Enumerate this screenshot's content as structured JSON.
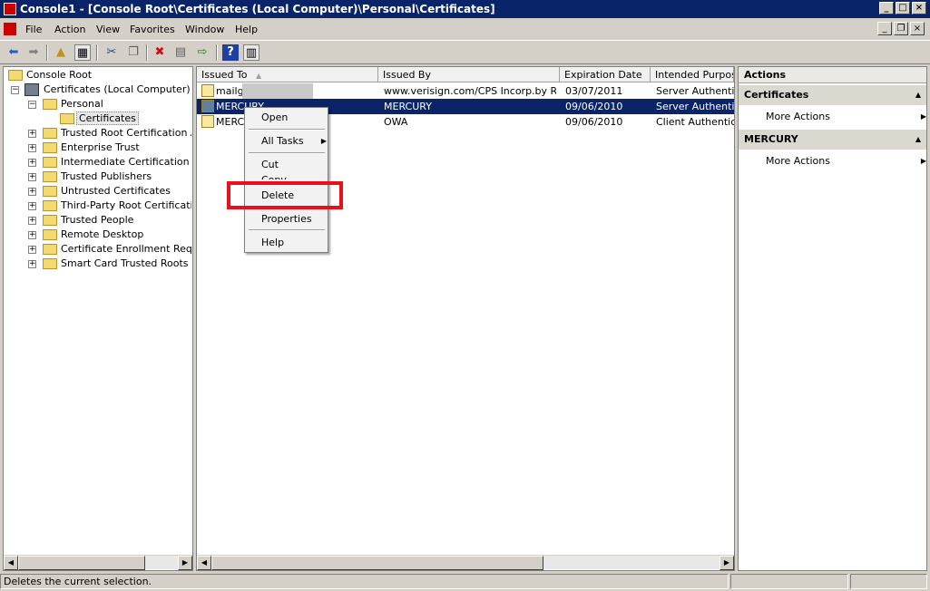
{
  "window": {
    "title": "Console1 - [Console Root\\Certificates (Local Computer)\\Personal\\Certificates]"
  },
  "menu": [
    "File",
    "Action",
    "View",
    "Favorites",
    "Window",
    "Help"
  ],
  "toolbar": {
    "icons": [
      "back-icon",
      "forward-icon",
      "up-folder-icon",
      "show-hide-tree-icon",
      "cut-icon",
      "copy-icon",
      "delete-icon",
      "properties-icon",
      "export-icon",
      "help-icon",
      "action-pane-icon"
    ]
  },
  "tree": {
    "root": "Console Root",
    "computer": "Certificates (Local Computer)",
    "personal": "Personal",
    "certificates": "Certificates",
    "stores": [
      "Trusted Root Certification Aut",
      "Enterprise Trust",
      "Intermediate Certification Auth",
      "Trusted Publishers",
      "Untrusted Certificates",
      "Third-Party Root Certification",
      "Trusted People",
      "Remote Desktop",
      "Certificate Enrollment Request",
      "Smart Card Trusted Roots"
    ]
  },
  "list": {
    "columns": [
      "Issued To",
      "Issued By",
      "Expiration Date",
      "Intended Purpose"
    ],
    "rows": [
      {
        "issued_to": "mailg",
        "issued_by": "www.verisign.com/CPS Incorp.by R...",
        "expires": "03/07/2011",
        "purpose": "Server Authentica"
      },
      {
        "issued_to": "MERCURY",
        "issued_by": "MERCURY",
        "expires": "09/06/2010",
        "purpose": "Server Authentica"
      },
      {
        "issued_to": "MERCU",
        "issued_by": "OWA",
        "expires": "09/06/2010",
        "purpose": "Client Authenticat"
      }
    ]
  },
  "context_menu": {
    "open": "Open",
    "all_tasks": "All Tasks",
    "cut": "Cut",
    "copy": "Copy",
    "delete": "Delete",
    "properties": "Properties",
    "help": "Help"
  },
  "actions": {
    "title": "Actions",
    "sections": [
      {
        "header": "Certificates",
        "item": "More Actions"
      },
      {
        "header": "MERCURY",
        "item": "More Actions"
      }
    ]
  },
  "status": {
    "text": "Deletes the current selection."
  },
  "colors": {
    "selection": "#0a246a",
    "highlight_box": "#e8101a",
    "title_bar": "#0a246a"
  }
}
